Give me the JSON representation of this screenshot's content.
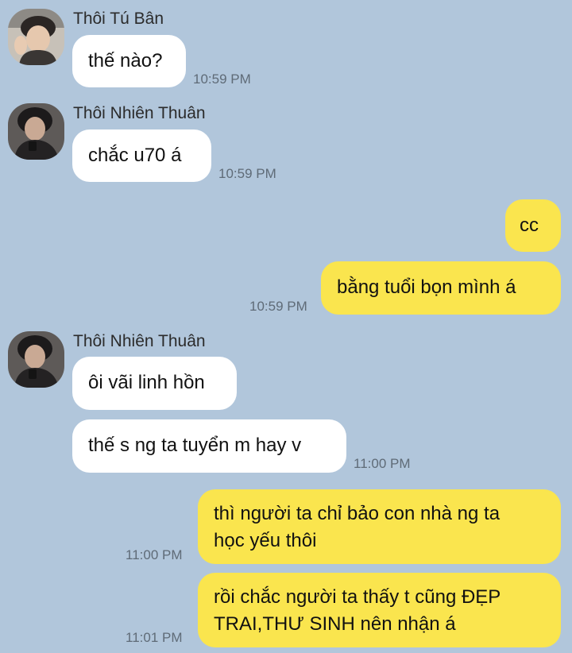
{
  "messages": [
    {
      "sender": "Thôi Tú Bân",
      "text": "thế nào?",
      "time": "10:59 PM"
    },
    {
      "sender": "Thôi Nhiên Thuân",
      "text": "chắc u70 á",
      "time": "10:59 PM"
    },
    {
      "text": "cc"
    },
    {
      "text": "bằng tuổi bọn mình á",
      "time": "10:59 PM"
    },
    {
      "sender": "Thôi Nhiên Thuân",
      "text": "ôi vãi linh hồn"
    },
    {
      "text": "thế s ng ta tuyển m hay v",
      "time": "11:00 PM"
    },
    {
      "line1": "thì người ta chỉ bảo con nhà ng ta",
      "line2": "học yếu thôi",
      "time": "11:00 PM"
    },
    {
      "line1": "rồi chắc người ta thấy t cũng ĐẸP",
      "line2": "TRAI,THƯ SINH nên nhận á",
      "time": "11:01 PM"
    }
  ],
  "colors": {
    "background": "#b1c6db",
    "incoming_bubble": "#ffffff",
    "outgoing_bubble": "#fae54e"
  }
}
